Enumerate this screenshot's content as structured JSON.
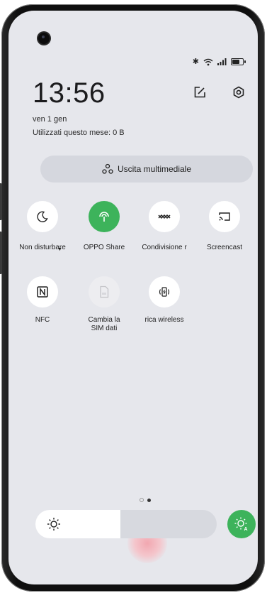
{
  "status_bar": {
    "bluetooth": "✱",
    "wifi": "wifi",
    "signal": "signal",
    "battery_level": 0.6
  },
  "header": {
    "time": "13:56",
    "date": "ven 1 gen",
    "usage": "Utilizzati questo mese: 0 B",
    "edit_icon": "edit-icon",
    "settings_icon": "settings-icon"
  },
  "media_output": {
    "label": "Uscita multimediale",
    "icon": "media-output-icon"
  },
  "tiles": [
    {
      "label": "Non disturbare",
      "icon": "moon-icon",
      "state": "off"
    },
    {
      "label": "OPPO Share",
      "icon": "oppo-share-icon",
      "state": "on"
    },
    {
      "label": "Condivisione r",
      "icon": "share-icon",
      "state": "off"
    },
    {
      "label": "Screencast",
      "icon": "screencast-icon",
      "state": "off"
    },
    {
      "label": "NFC",
      "icon": "nfc-icon",
      "state": "off"
    },
    {
      "label": "Cambia la SIM dati",
      "icon": "sim-icon",
      "state": "disabled"
    },
    {
      "label": "rica wireless",
      "icon": "wireless-charge-icon",
      "state": "off"
    }
  ],
  "pager": {
    "pages": 2,
    "current": 2
  },
  "brightness": {
    "level": 0.47,
    "auto": true
  },
  "colors": {
    "accent": "#3db35b",
    "panel": "#e6e7ec"
  }
}
